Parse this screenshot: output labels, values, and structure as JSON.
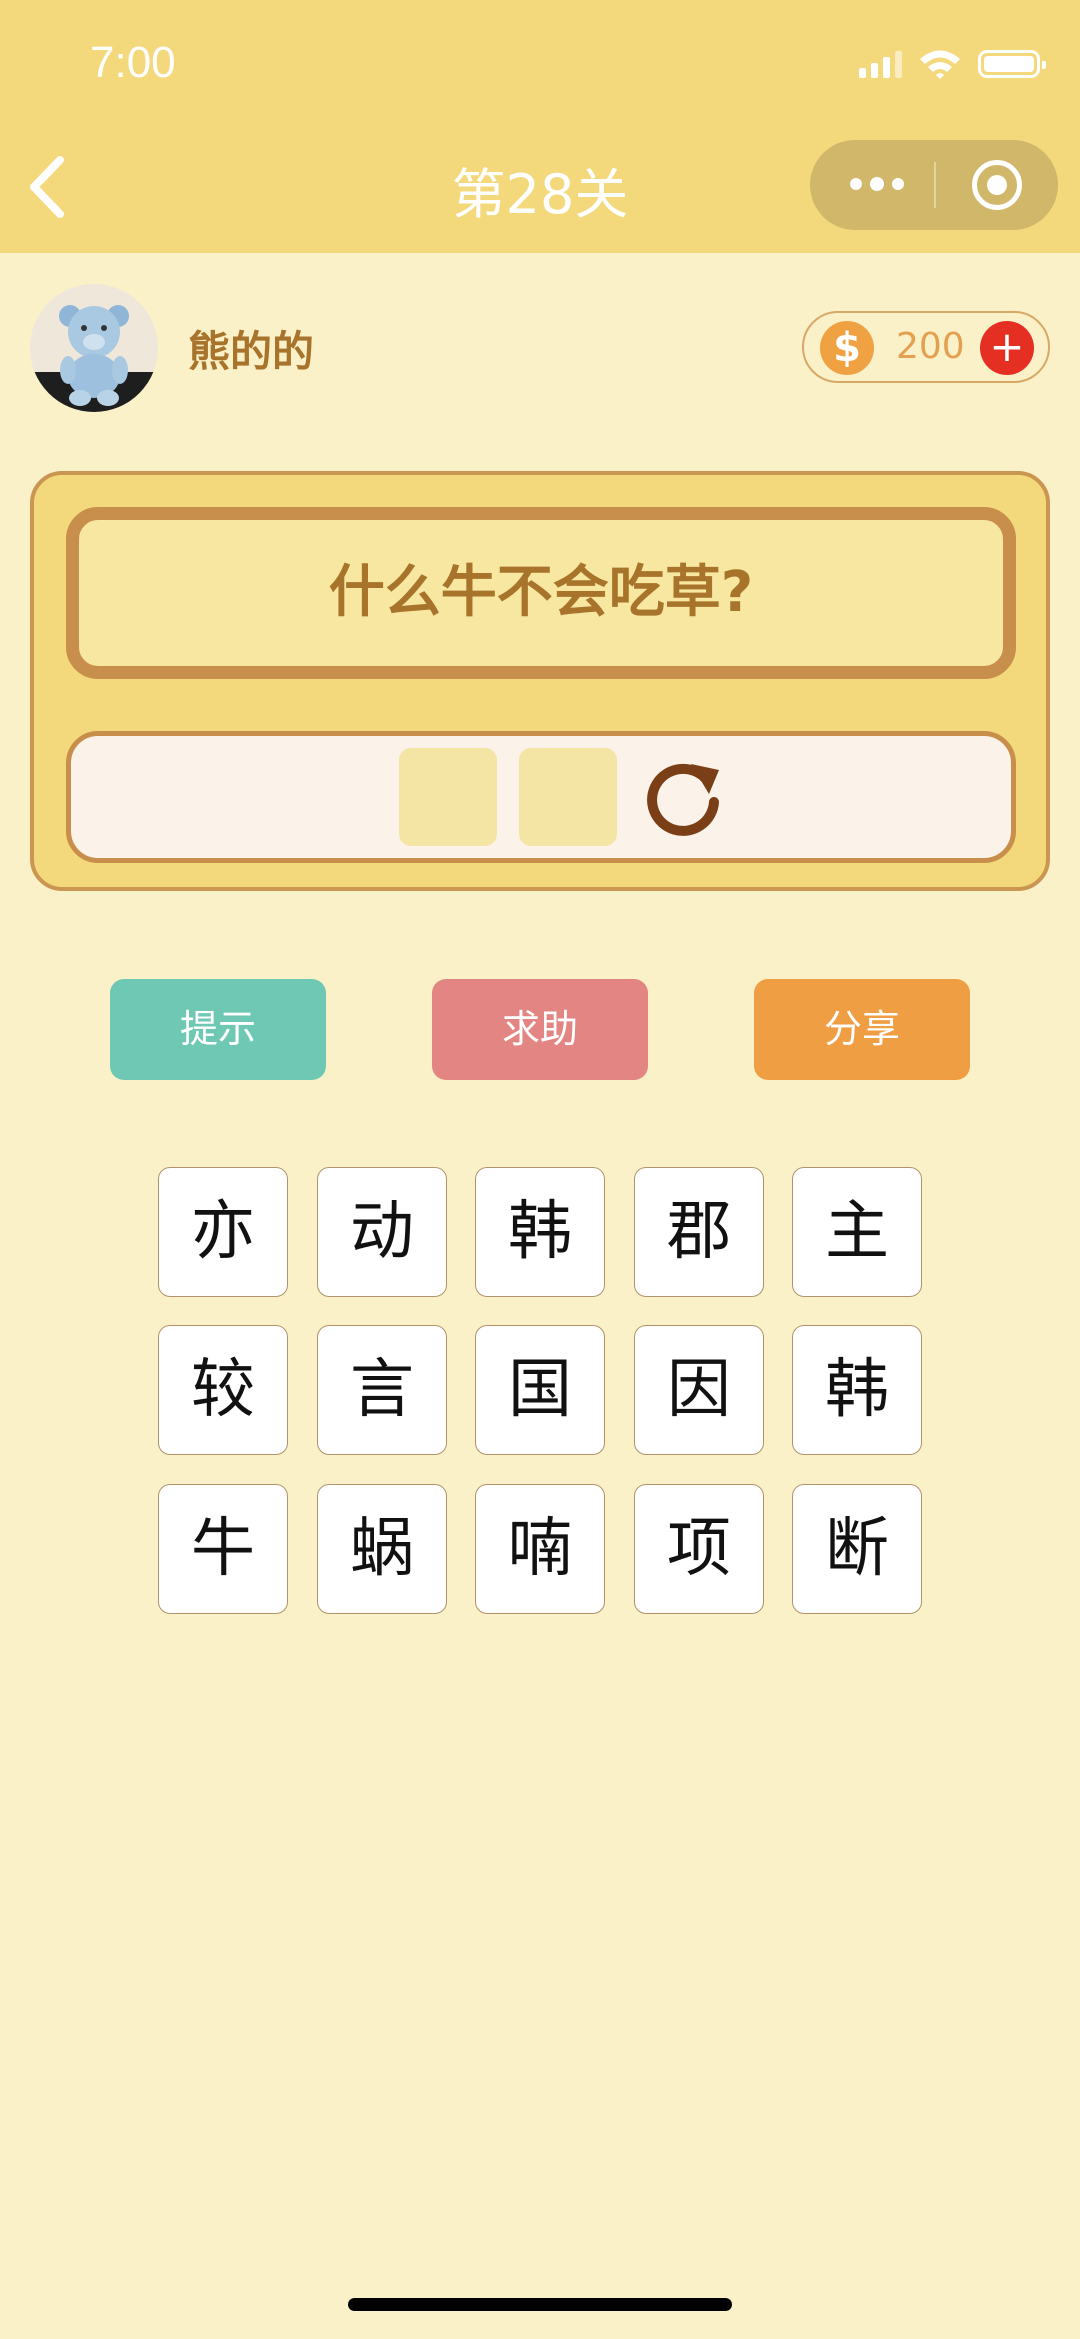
{
  "status_bar": {
    "time": "7:00"
  },
  "nav": {
    "title": "第28关"
  },
  "user": {
    "name": "熊的的",
    "coins": "200"
  },
  "question": {
    "text": "什么牛不会吃草?"
  },
  "answer": {
    "slot_count": 2
  },
  "actions": {
    "hint": "提示",
    "help": "求助",
    "share": "分享"
  },
  "characters": [
    [
      "亦",
      "动",
      "韩",
      "郡",
      "主"
    ],
    [
      "较",
      "言",
      "国",
      "因",
      "韩"
    ],
    [
      "牛",
      "蜗",
      "喃",
      "项",
      "断"
    ]
  ],
  "colors": {
    "background": "#fbf1c8",
    "header": "#f3d87c",
    "panel_border": "#c78f4b",
    "hint_button": "#6ec8b4",
    "help_button": "#e38683",
    "share_button": "#f09e43",
    "coin": "#f0a142",
    "add": "#e52f23"
  },
  "icons": {
    "back": "chevron-left-icon",
    "more": "more-dots-icon",
    "close": "target-icon",
    "coin": "dollar-coin-icon",
    "add": "plus-icon",
    "reset": "refresh-icon"
  }
}
